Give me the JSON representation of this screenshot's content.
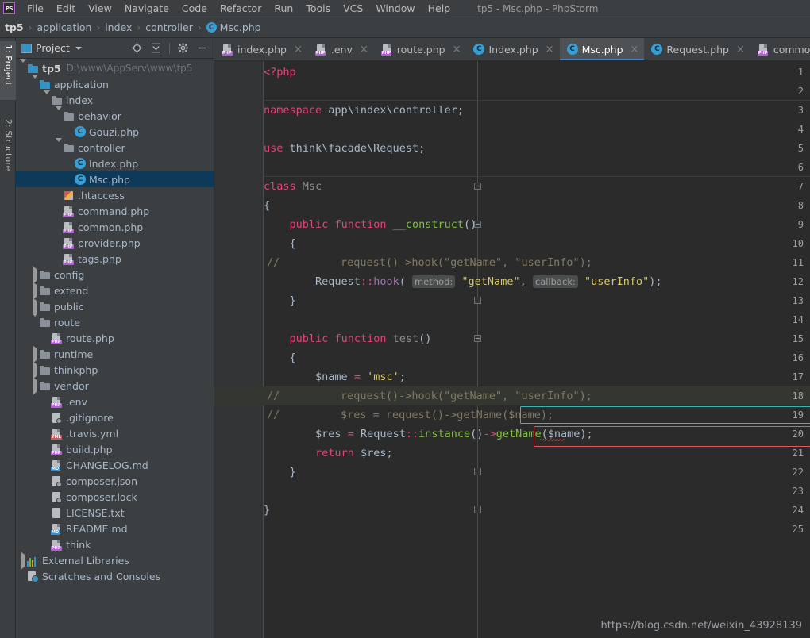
{
  "window": {
    "title": "tp5 - Msc.php - PhpStorm",
    "logo": "phpstorm-logo"
  },
  "menu": {
    "items": [
      {
        "label": "File"
      },
      {
        "label": "Edit"
      },
      {
        "label": "View"
      },
      {
        "label": "Navigate"
      },
      {
        "label": "Code"
      },
      {
        "label": "Refactor"
      },
      {
        "label": "Run"
      },
      {
        "label": "Tools"
      },
      {
        "label": "VCS"
      },
      {
        "label": "Window"
      },
      {
        "label": "Help"
      }
    ]
  },
  "breadcrumb": {
    "items": [
      "tp5",
      "application",
      "index",
      "controller"
    ],
    "file": "Msc.php",
    "separator": "›"
  },
  "tool_tabs": [
    {
      "label": "1: Project",
      "active": true
    },
    {
      "label": "2: Structure",
      "active": false
    }
  ],
  "project_panel": {
    "title": "Project",
    "tools": [
      "locate-icon",
      "collapse-all-icon",
      "gear-icon",
      "minimize-icon"
    ],
    "tree": [
      {
        "label": "tp5",
        "detail": "D:\\www\\AppServ\\www\\tp5",
        "icon": "folder-blue",
        "indent": 0,
        "arrow": "down",
        "bold": true
      },
      {
        "label": "application",
        "icon": "folder-blue",
        "indent": 1,
        "arrow": "down"
      },
      {
        "label": "index",
        "icon": "folder",
        "indent": 2,
        "arrow": "down"
      },
      {
        "label": "behavior",
        "icon": "folder",
        "indent": 3,
        "arrow": "down"
      },
      {
        "label": "Gouzi.php",
        "icon": "class",
        "indent": 4,
        "arrow": "none"
      },
      {
        "label": "controller",
        "icon": "folder",
        "indent": 3,
        "arrow": "down"
      },
      {
        "label": "Index.php",
        "icon": "class",
        "indent": 4,
        "arrow": "none"
      },
      {
        "label": "Msc.php",
        "icon": "class",
        "indent": 4,
        "arrow": "none",
        "selected": true
      },
      {
        "label": ".htaccess",
        "icon": "htaccess",
        "indent": 3,
        "arrow": "none"
      },
      {
        "label": "command.php",
        "icon": "php",
        "indent": 3,
        "arrow": "none"
      },
      {
        "label": "common.php",
        "icon": "php",
        "indent": 3,
        "arrow": "none"
      },
      {
        "label": "provider.php",
        "icon": "php",
        "indent": 3,
        "arrow": "none"
      },
      {
        "label": "tags.php",
        "icon": "php",
        "indent": 3,
        "arrow": "none"
      },
      {
        "label": "config",
        "icon": "folder",
        "indent": 1,
        "arrow": "right"
      },
      {
        "label": "extend",
        "icon": "folder",
        "indent": 1,
        "arrow": "right"
      },
      {
        "label": "public",
        "icon": "folder",
        "indent": 1,
        "arrow": "right"
      },
      {
        "label": "route",
        "icon": "folder",
        "indent": 1,
        "arrow": "down"
      },
      {
        "label": "route.php",
        "icon": "php",
        "indent": 2,
        "arrow": "none"
      },
      {
        "label": "runtime",
        "icon": "folder",
        "indent": 1,
        "arrow": "right"
      },
      {
        "label": "thinkphp",
        "icon": "folder",
        "indent": 1,
        "arrow": "right"
      },
      {
        "label": "vendor",
        "icon": "folder",
        "indent": 1,
        "arrow": "right"
      },
      {
        "label": ".env",
        "icon": "php",
        "indent": 2,
        "arrow": "none"
      },
      {
        "label": ".gitignore",
        "icon": "misc",
        "indent": 2,
        "arrow": "none"
      },
      {
        "label": ".travis.yml",
        "icon": "yml",
        "indent": 2,
        "arrow": "none"
      },
      {
        "label": "build.php",
        "icon": "php",
        "indent": 2,
        "arrow": "none"
      },
      {
        "label": "CHANGELOG.md",
        "icon": "md",
        "indent": 2,
        "arrow": "none"
      },
      {
        "label": "composer.json",
        "icon": "misc",
        "indent": 2,
        "arrow": "none"
      },
      {
        "label": "composer.lock",
        "icon": "misc",
        "indent": 2,
        "arrow": "none"
      },
      {
        "label": "LICENSE.txt",
        "icon": "txt",
        "indent": 2,
        "arrow": "none"
      },
      {
        "label": "README.md",
        "icon": "md",
        "indent": 2,
        "arrow": "none"
      },
      {
        "label": "think",
        "icon": "php",
        "indent": 2,
        "arrow": "none"
      },
      {
        "label": "External Libraries",
        "icon": "libraries",
        "indent": 0,
        "arrow": "right"
      },
      {
        "label": "Scratches and Consoles",
        "icon": "scratches",
        "indent": 0,
        "arrow": "none"
      }
    ]
  },
  "editor": {
    "tabs": [
      {
        "label": "index.php",
        "icon": "php-file",
        "active": false
      },
      {
        "label": ".env",
        "icon": "php-file",
        "active": false
      },
      {
        "label": "route.php",
        "icon": "php-file",
        "active": false
      },
      {
        "label": "Index.php",
        "icon": "class-file",
        "active": false
      },
      {
        "label": "Msc.php",
        "icon": "class-file",
        "active": true
      },
      {
        "label": "Request.php",
        "icon": "class-file",
        "active": false
      },
      {
        "label": "common.php",
        "icon": "php-file",
        "active": false
      }
    ],
    "close_glyph": "×",
    "current_line": 18,
    "line_count": 25,
    "lines": [
      "<?php",
      "",
      "namespace app\\index\\controller;",
      "",
      "use think\\facade\\Request;",
      "",
      "class Msc",
      "{",
      "    public function __construct()",
      "    {",
      "//        request()->hook(\"getName\", \"userInfo\");",
      "        Request::hook( method: \"getName\", callback: \"userInfo\");",
      "    }",
      "",
      "    public function test()",
      "    {",
      "        $name = 'msc';",
      "//        request()->hook(\"getName\", \"userInfo\");",
      "//        $res = request()->getName($name);",
      "        $res = Request::instance()->getName($name);",
      "        return $res;",
      "    }",
      "",
      "}",
      ""
    ],
    "param_hints": [
      "method:",
      "callback:"
    ],
    "annotations": [
      {
        "type": "box",
        "color": "#37b5b5",
        "line": 19,
        "note": "cyan-highlight-box"
      },
      {
        "type": "box",
        "color": "#e05c5c",
        "line": 20,
        "note": "red-highlight-box"
      }
    ]
  },
  "watermark": {
    "text": "https://blog.csdn.net/weixin_43928139"
  },
  "colors": {
    "bg_chrome": "#3c3f41",
    "bg_editor": "#2b2b2b",
    "gutter": "#313335",
    "accent_blue": "#3d87d0",
    "selection": "#0d3a58",
    "keyword": "#e0457b",
    "string": "#d8c76c",
    "comment": "#7f7a63",
    "function": "#7fbf3f",
    "static": "#9876aa",
    "box_cyan": "#37b5b5",
    "box_red": "#e05c5c",
    "current_line": "#343631"
  }
}
